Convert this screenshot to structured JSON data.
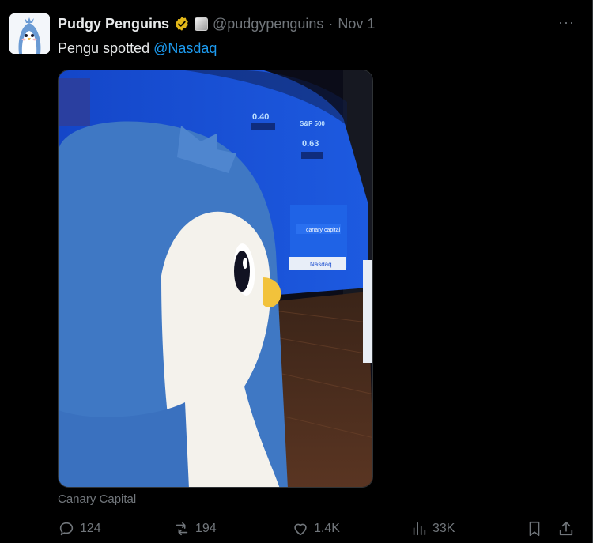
{
  "tweet": {
    "author_name": "Pudgy Penguins",
    "handle": "@pudgypenguins",
    "separator": "·",
    "time": "Nov 1",
    "more_label": "···",
    "text_prefix": "Pengu spotted ",
    "mention": "@Nasdaq",
    "media_caption": "Canary Capital",
    "verified_color": "#e2b719",
    "accent_color": "#1d9bf0"
  },
  "actions": {
    "replies": "124",
    "reposts": "194",
    "likes": "1.4K",
    "views": "33K"
  },
  "icons": {
    "reply": "reply-icon",
    "repost": "repost-icon",
    "like": "heart-icon",
    "views": "views-bar-icon",
    "bookmark": "bookmark-icon",
    "share": "share-icon"
  },
  "screen": {
    "ticker_pct_1": "0.40",
    "ticker_label_2": "S&P 500",
    "ticker_pct_2": "0.63",
    "logo_text": "canary capital",
    "podium_text": "Nasdaq"
  }
}
